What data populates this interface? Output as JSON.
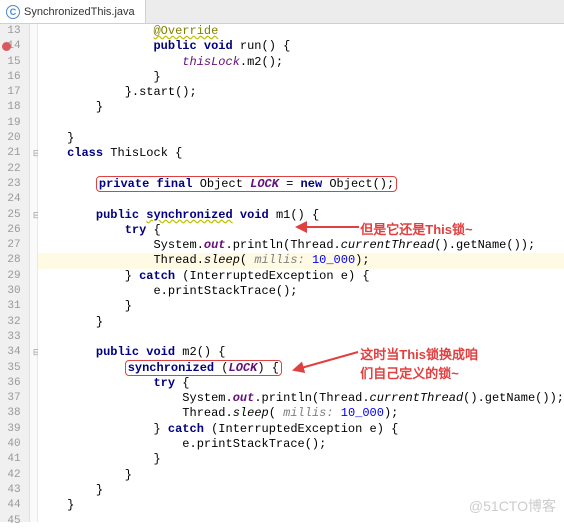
{
  "tab": {
    "filename": "SynchronizedThis.java",
    "icon_letter": "C"
  },
  "gutter": {
    "start": 13,
    "end": 45,
    "breakpoint_lines": [
      14
    ]
  },
  "code": {
    "l13": {
      "ann": "@Override",
      "warn": true
    },
    "l14": {
      "kw1": "public void",
      "mth": "run",
      "tail": "() {"
    },
    "l15": {
      "fld": "thisLock",
      "tail": ".m2();"
    },
    "l16": {
      "text": "}"
    },
    "l17": {
      "text": "}.start();"
    },
    "l18": {
      "text": "}"
    },
    "l19": {
      "text": ""
    },
    "l20": {
      "text": "}"
    },
    "l21": {
      "kw1": "class",
      "name": "ThisLock {"
    },
    "l22": {
      "text": ""
    },
    "l23": {
      "kw1": "private final",
      "type": "Object",
      "fld": "LOCK",
      "eq": " = ",
      "kw2": "new",
      "ctor": "Object();"
    },
    "l24": {
      "text": ""
    },
    "l25": {
      "kw1": "public",
      "kw2": "synchronized",
      "kw3": "void",
      "mth": "m1",
      "tail": "() {"
    },
    "l26": {
      "kw1": "try",
      "tail": " {"
    },
    "l27": {
      "pre": "System.",
      "fld": "out",
      "tail1": ".println(Thread.",
      "mth": "currentThread",
      "tail2": "().getName());"
    },
    "l28": {
      "pre": "Thread.",
      "mth": "sleep",
      "open": "(",
      "param": " millis: ",
      "num": "10_000",
      "close": ");"
    },
    "l29": {
      "open": "} ",
      "kw1": "catch",
      "tail": " (InterruptedException e) {"
    },
    "l30": {
      "text": "e.printStackTrace();"
    },
    "l31": {
      "text": "}"
    },
    "l32": {
      "text": "}"
    },
    "l33": {
      "text": ""
    },
    "l34": {
      "kw1": "public void",
      "mth": "m2",
      "tail": "() {"
    },
    "l35": {
      "kw1": "synchronized",
      "open": " (",
      "fld": "LOCK",
      "close": ") {"
    },
    "l36": {
      "kw1": "try",
      "tail": " {"
    },
    "l37": {
      "pre": "System.",
      "fld": "out",
      "tail1": ".println(Thread.",
      "mth": "currentThread",
      "tail2": "().getName());"
    },
    "l38": {
      "pre": "Thread.",
      "mth": "sleep",
      "open": "(",
      "param": " millis: ",
      "num": "10_000",
      "close": ");"
    },
    "l39": {
      "open": "} ",
      "kw1": "catch",
      "tail": " (InterruptedException e) {"
    },
    "l40": {
      "text": "e.printStackTrace();"
    },
    "l41": {
      "text": "}"
    },
    "l42": {
      "text": "}"
    },
    "l43": {
      "text": "}"
    },
    "l44": {
      "text": "}"
    },
    "l45": {
      "text": ""
    }
  },
  "annotations": {
    "a1": "但是它还是This锁~",
    "a2_line1": "这时当This锁换成咱",
    "a2_line2": "们自己定义的锁~"
  },
  "watermark": "@51CTO博客"
}
